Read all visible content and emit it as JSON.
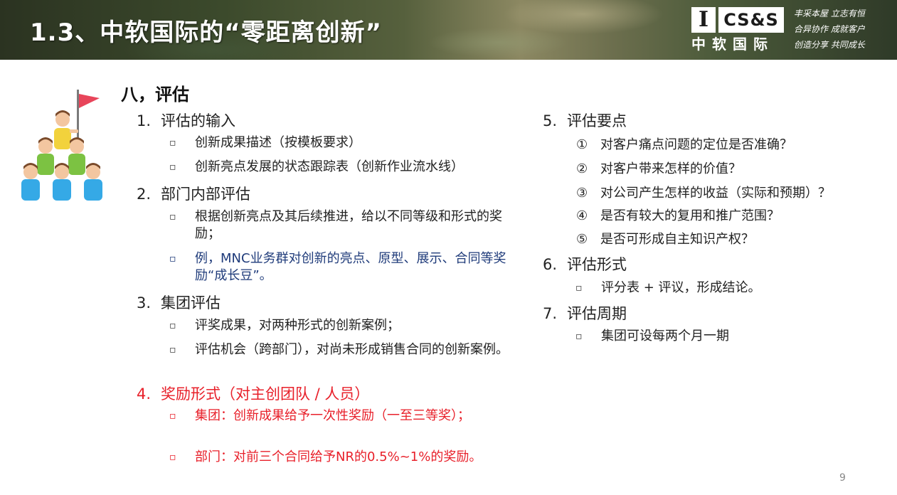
{
  "header": {
    "title": "1.3、中软国际的“零距离创新”",
    "logo_i": "I",
    "logo_css": "CS&S",
    "logo_cn": "中软国际",
    "slogans": [
      "丰采本屋 立志有恒",
      "合异协作 成就客户",
      "创造分享 共同成长"
    ]
  },
  "section": {
    "title": "八，评估"
  },
  "left": {
    "items": [
      {
        "num": "1.",
        "label": "评估的输入",
        "bullets": [
          "创新成果描述（按模板要求）",
          "创新亮点发展的状态跟踪表（创新作业流水线）"
        ]
      },
      {
        "num": "2.",
        "label": "部门内部评估",
        "bullets": [
          "根据创新亮点及其后续推进，给以不同等级和形式的奖励；",
          "例，MNC业务群对创新的亮点、原型、展示、合同等奖励“成长豆”。"
        ]
      },
      {
        "num": "3.",
        "label": "集团评估",
        "bullets": [
          "评奖成果，对两种形式的创新案例；",
          "评估机会（跨部门），对尚未形成销售合同的创新案例。"
        ]
      },
      {
        "num": "4.",
        "label": "奖励形式（对主创团队 / 人员）",
        "bullets": [
          "集团：创新成果给予一次性奖励（一至三等奖）；",
          "部门：对前三个合同给予NR的0.5%~1%的奖励。"
        ]
      }
    ]
  },
  "right": {
    "items": [
      {
        "num": "5.",
        "label": "评估要点",
        "points": [
          {
            "mark": "①",
            "text": "对客户痛点问题的定位是否准确？"
          },
          {
            "mark": "②",
            "text": "对客户带来怎样的价值？"
          },
          {
            "mark": "③",
            "text": "对公司产生怎样的收益（实际和预期）？"
          },
          {
            "mark": "④",
            "text": "是否有较大的复用和推广范围？"
          },
          {
            "mark": "⑤",
            "text": "是否可形成自主知识产权？"
          }
        ]
      },
      {
        "num": "6.",
        "label": "评估形式",
        "bullets": [
          "评分表 + 评议，形成结论。"
        ]
      },
      {
        "num": "7.",
        "label": "评估周期",
        "bullets": [
          "集团可设每两个月一期"
        ]
      }
    ]
  },
  "bullet_marker": "▫",
  "page_number": "9",
  "colors": {
    "highlight_blue": "#1f3b7a",
    "highlight_red": "#e8202a",
    "flag_red": "#e8455a"
  }
}
